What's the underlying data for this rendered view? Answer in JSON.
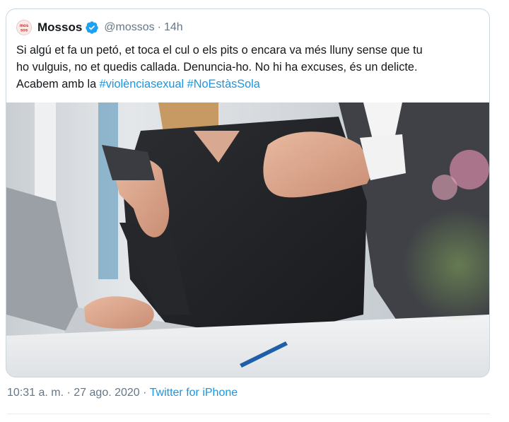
{
  "tweet": {
    "author": {
      "display_name": "Mossos",
      "handle": "@mossos",
      "avatar_text": "mos sos",
      "verified_icon": "verified-badge-icon"
    },
    "separator": "·",
    "relative_time": "14h",
    "text_lines": [
      [
        "Si algú et fa un petó, et toca el cul o els pits o encara va més lluny sense que tu"
      ],
      [
        "ho vulguis, no et quedis callada. Denuncia-ho. No hi ha excuses, és un delicte."
      ],
      [
        "Acabem amb la ",
        "#violènciasexual",
        " ",
        "#NoEstàsSola"
      ]
    ],
    "text": {
      "line1": "Si algú et fa un petó, et toca el cul o els pits o encara va més lluny sense que tu",
      "line2": "ho vulguis, no et quedis callada. Denuncia-ho. No hi ha excuses, és un delicte.",
      "line3_prefix": "Acabem amb la ",
      "hashtag1": "#violènciasexual",
      "hashtag2": "#NoEstàsSola"
    },
    "timestamp": "10:31 a. m.",
    "date": "27 ago. 2020",
    "source": "Twitter for iPhone"
  },
  "colors": {
    "link": "#1b95e0",
    "secondary_text": "#657786",
    "verified": "#1da1f2",
    "brand_red": "#d52b1e"
  }
}
